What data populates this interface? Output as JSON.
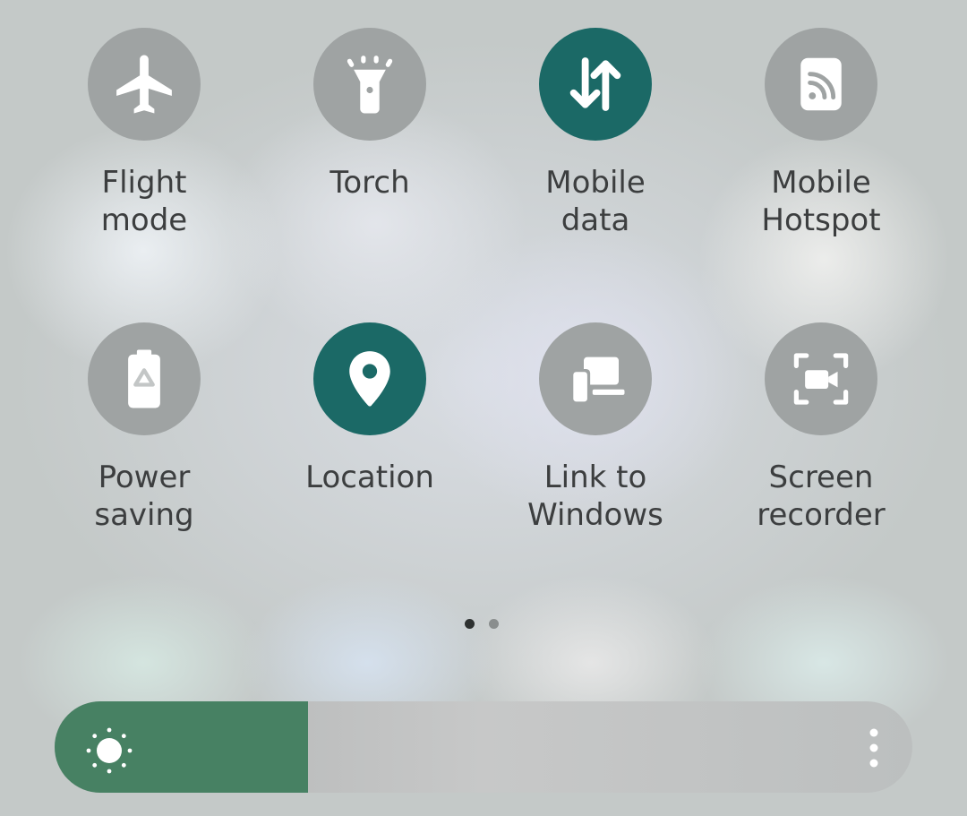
{
  "tiles": [
    {
      "label": "Flight\nmode",
      "icon": "airplane-icon",
      "state": "off"
    },
    {
      "label": "Torch",
      "icon": "flashlight-icon",
      "state": "off"
    },
    {
      "label": "Mobile\ndata",
      "icon": "data-arrows-icon",
      "state": "on"
    },
    {
      "label": "Mobile\nHotspot",
      "icon": "hotspot-icon",
      "state": "off"
    },
    {
      "label": "Power\nsaving",
      "icon": "battery-recycle-icon",
      "state": "off"
    },
    {
      "label": "Location",
      "icon": "location-pin-icon",
      "state": "on"
    },
    {
      "label": "Link to\nWindows",
      "icon": "link-to-windows-icon",
      "state": "off"
    },
    {
      "label": "Screen\nrecorder",
      "icon": "screen-recorder-icon",
      "state": "off"
    }
  ],
  "pagination": {
    "current": 1,
    "total": 2
  },
  "brightness": {
    "level": 0.295,
    "icon": "sun-icon",
    "menu_icon": "more-vertical-icon"
  },
  "colors": {
    "tile_on": "#1b6966",
    "tile_off": "#9fa3a3",
    "brightness_fill": "#478163",
    "label_text": "#3c3e3f"
  }
}
